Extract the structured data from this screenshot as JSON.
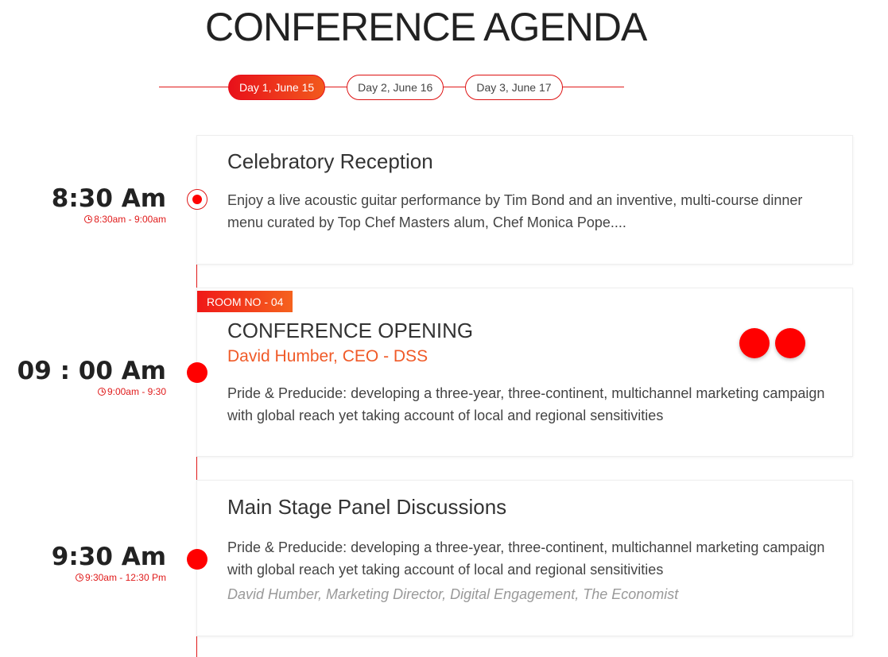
{
  "page": {
    "title": "CONFERENCE AGENDA"
  },
  "tabs": [
    {
      "label": "Day 1, June 15",
      "active": true
    },
    {
      "label": "Day 2, June 16",
      "active": false
    },
    {
      "label": "Day 3, June 17",
      "active": false
    }
  ],
  "colors": {
    "accent": "#e8101a",
    "accent_secondary": "#f25a1d",
    "speaker": "#f05a28",
    "text": "#333333",
    "muted": "#999999"
  },
  "icons": {
    "time": "clock-icon"
  },
  "sessions": [
    {
      "time": "8:30 Am",
      "range": "8:30am - 9:00am",
      "title": "Celebratory Reception",
      "description": "Enjoy a live acoustic guitar performance by Tim Bond and an inventive, multi-course dinner menu curated by Top Chef Masters alum, Chef Monica Pope...."
    },
    {
      "time": "09 : 00 Am",
      "range": "9:00am - 9:30",
      "room": "ROOM NO - 04",
      "title": "CONFERENCE OPENING",
      "speaker": "David Humber, CEO - DSS",
      "description": "Pride & Preducide: developing a three-year, three-continent, multichannel marketing campaign with global reach yet taking account of local and regional sensitivities"
    },
    {
      "time": "9:30 Am",
      "range": "9:30am - 12:30 Pm",
      "title": "Main Stage Panel Discussions",
      "description": "Pride & Preducide: developing a three-year, three-continent, multichannel marketing campaign with global reach yet taking account of local and regional sensitivities",
      "credit": "David Humber, Marketing Director, Digital Engagement, The Economist"
    }
  ]
}
